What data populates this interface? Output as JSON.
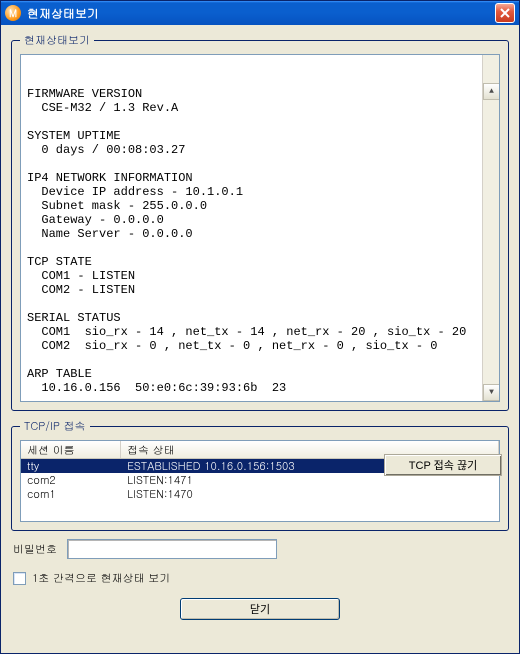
{
  "window": {
    "title": "현재상태보기",
    "icon_letter": "M"
  },
  "status_group": {
    "legend": "현재상태보기",
    "lines": [
      "FIRMWARE VERSION",
      "  CSE-M32 / 1.3 Rev.A",
      "",
      "SYSTEM UPTIME",
      "  0 days / 00:08:03.27",
      "",
      "IP4 NETWORK INFORMATION",
      "  Device IP address - 10.1.0.1",
      "  Subnet mask - 255.0.0.0",
      "  Gateway - 0.0.0.0",
      "  Name Server - 0.0.0.0",
      "",
      "TCP STATE",
      "  COM1 - LISTEN",
      "  COM2 - LISTEN",
      "",
      "SERIAL STATUS",
      "  COM1  sio_rx - 14 , net_tx - 14 , net_rx - 20 , sio_tx - 20",
      "  COM2  sio_rx - 0 , net_tx - 0 , net_rx - 0 , sio_tx - 0",
      "",
      "ARP TABLE",
      "  10.16.0.156  50:e0:6c:39:93:6b  23"
    ]
  },
  "tcpip": {
    "legend": "TCP/IP 접속",
    "headers": {
      "session": "세션 이름",
      "state": "접속 상태"
    },
    "rows": [
      {
        "name": "tty",
        "state": "ESTABLISHED 10.16.0.156:1503",
        "selected": true
      },
      {
        "name": "com2",
        "state": "LISTEN:1471",
        "selected": false
      },
      {
        "name": "com1",
        "state": "LISTEN:1470",
        "selected": false
      }
    ],
    "disconnect_label": "TCP 접속 끊기"
  },
  "password": {
    "label": "비밀번호",
    "value": ""
  },
  "refresh": {
    "label": "1초 간격으로 현재상태 보기",
    "checked": false
  },
  "close_label": "닫기"
}
